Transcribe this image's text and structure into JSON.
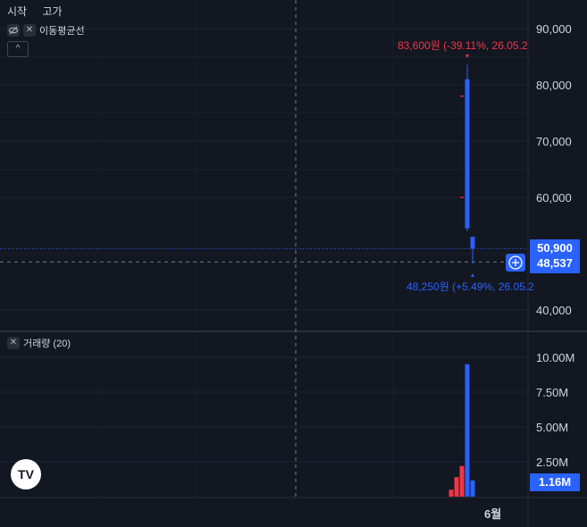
{
  "legend": {
    "open_label": "시작",
    "high_label": "고가"
  },
  "ma_label": "이동평균선",
  "volume_label": "거래량 (20)",
  "logo_text": "TV",
  "icons": {
    "eye": "eye-off-icon",
    "close": "close-icon",
    "chevron": "chevron-up-icon",
    "plus": "plus-circle-icon"
  },
  "colors": {
    "up": "#2962ff",
    "down": "#f23645",
    "up_badge": "#2962ff"
  },
  "chart_data": [
    {
      "type": "candlestick",
      "y_ticks": [
        "90,000",
        "80,000",
        "70,000",
        "60,000",
        "40,000"
      ],
      "y_tick_values": [
        90000,
        80000,
        70000,
        60000,
        40000
      ],
      "ylim": [
        36000,
        94000
      ],
      "candles": [
        {
          "open": 54500,
          "high": 83600,
          "low": 54000,
          "close": 81000,
          "color": "up"
        },
        {
          "open": 53000,
          "high": 53000,
          "low": 48250,
          "close": 50900,
          "color": "up"
        }
      ],
      "ma_points": [
        78000,
        60000
      ],
      "high_annotation": "83,600원 (-39.11%, 26.05.2",
      "low_annotation": "48,250원 (+5.49%, 26.05.2",
      "last_price_label": "50,900",
      "last_price": 50900,
      "crosshair_price_label": "48,537",
      "crosshair_price": 48537,
      "x_labels": [
        "6월"
      ]
    },
    {
      "type": "bar",
      "title": "거래량 (20)",
      "y_ticks": [
        "10.00M",
        "7.50M",
        "5.00M",
        "2.50M"
      ],
      "y_tick_values": [
        10000000,
        7500000,
        5000000,
        2500000
      ],
      "ylim": [
        0,
        11000000
      ],
      "values": [
        500000,
        1400000,
        2200000,
        9500000,
        1160000
      ],
      "colors": [
        "down",
        "down",
        "down",
        "up",
        "up"
      ],
      "last_value_label": "1.16M",
      "last_value": 1160000
    }
  ]
}
